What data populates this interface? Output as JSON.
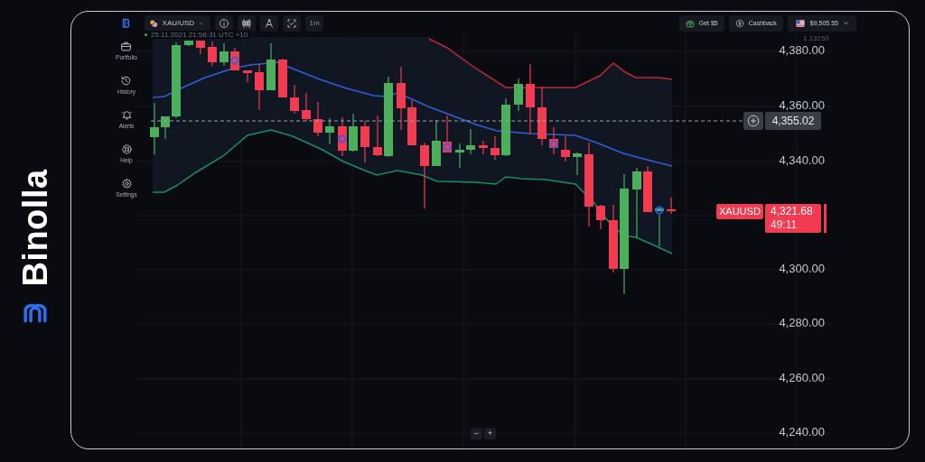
{
  "brand": {
    "name": "Binolla"
  },
  "sidebar": {
    "items": [
      {
        "label": "Portfolio"
      },
      {
        "label": "History"
      },
      {
        "label": "Alerts"
      },
      {
        "label": "Help"
      },
      {
        "label": "Settings"
      }
    ]
  },
  "toolbar": {
    "asset": "XAU/USD",
    "timeframe": "1m",
    "bonus": "Get $5",
    "cashback": "Cashback",
    "balance": "$9,505.55"
  },
  "chart": {
    "timestamp": "25.11.2021 21:58:31 UTC +10",
    "corner_value": "1.13150",
    "price_axis": [
      "4,380.00",
      "4,360.00",
      "4,340.00",
      "4,300.00",
      "4,280.00",
      "4,260.00",
      "4,240.00"
    ],
    "line_price": "4,355.02",
    "symbol": "XAUUSD",
    "current_price": "4,321.68",
    "countdown": "49:11",
    "zoom": [
      "−",
      "+"
    ]
  }
}
